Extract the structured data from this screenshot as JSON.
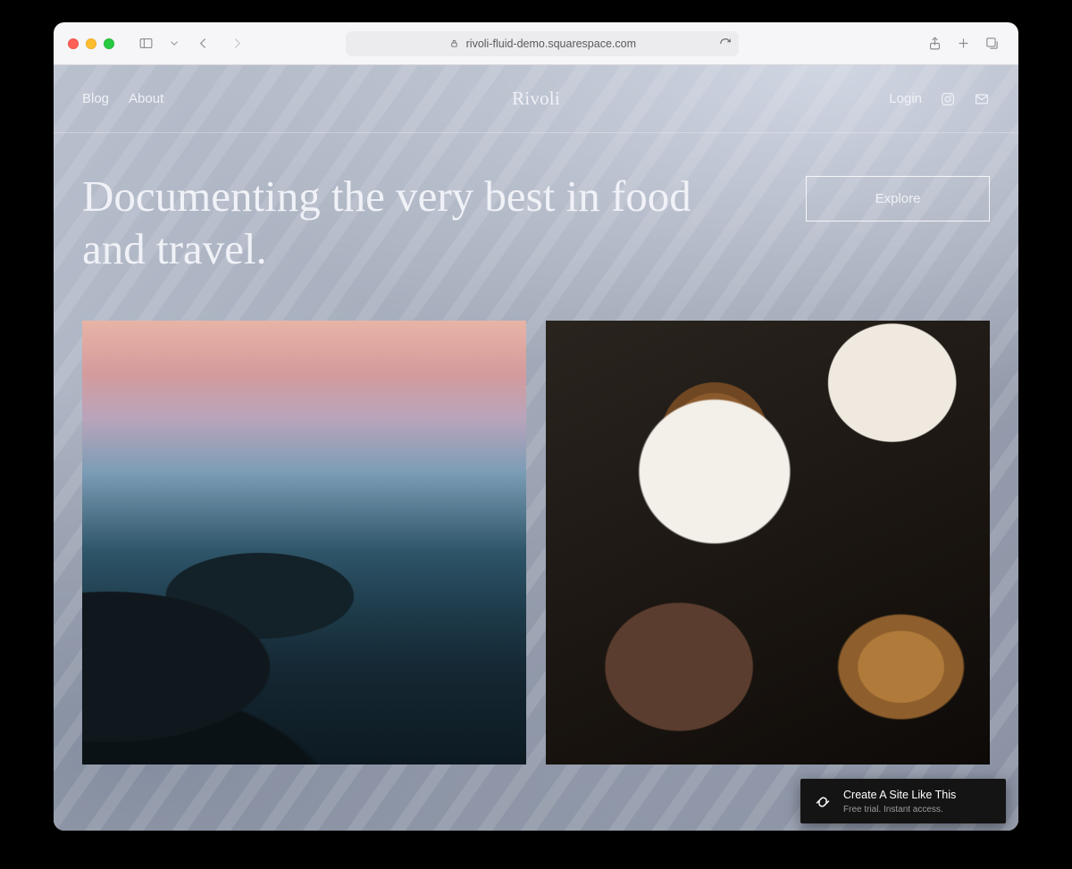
{
  "browser": {
    "url": "rivoli-fluid-demo.squarespace.com"
  },
  "header": {
    "brand": "Rivoli",
    "nav": [
      "Blog",
      "About"
    ],
    "login": "Login"
  },
  "hero": {
    "heading": "Documenting the very best in food and travel.",
    "cta": "Explore"
  },
  "cards": [
    {
      "alt": "Coastal cliffs at sunset"
    },
    {
      "alt": "Espresso and croissant on a café table"
    }
  ],
  "promo": {
    "title": "Create A Site Like This",
    "subtitle": "Free trial. Instant access."
  }
}
